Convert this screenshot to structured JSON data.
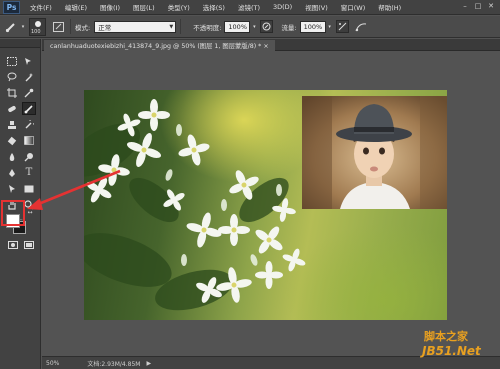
{
  "menubar": {
    "logo": "Ps",
    "items": [
      "文件(F)",
      "编辑(E)",
      "图像(I)",
      "图层(L)",
      "类型(Y)",
      "选择(S)",
      "滤镜(T)",
      "3D(D)",
      "视图(V)",
      "窗口(W)",
      "帮助(H)"
    ],
    "window_controls": [
      "–",
      "□",
      "✕"
    ]
  },
  "options": {
    "brush_size": "100",
    "mode_label": "模式:",
    "mode_value": "正常",
    "opacity_label": "不透明度:",
    "opacity_value": "100%",
    "flow_label": "流量:",
    "flow_value": "100%"
  },
  "document": {
    "tab_title": "canlanhuaduotexiebizhi_413874_9.jpg @ 50% (图层 1, 图层蒙版/8) * ×"
  },
  "status": {
    "zoom": "50%",
    "doc_size": "文档:2.93M/4.85M"
  },
  "watermark": {
    "brand": "脚本之家",
    "domain": "JB51.Net"
  }
}
